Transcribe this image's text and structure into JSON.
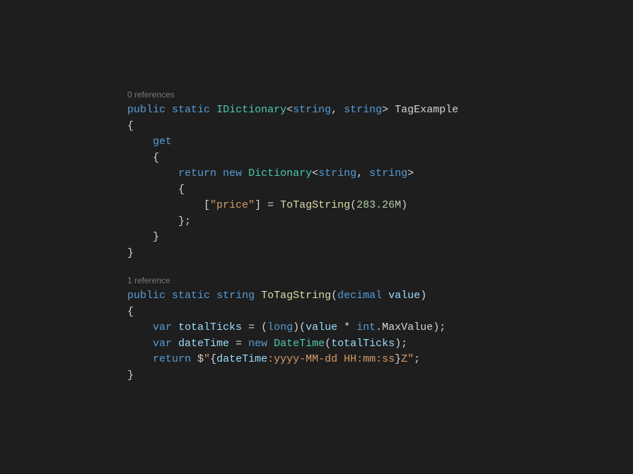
{
  "block1": {
    "codelens": "0 references",
    "l1": {
      "k_public": "public",
      "k_static": "static",
      "t_idict": "IDictionary",
      "lt": "<",
      "k_string1": "string",
      "comma": ", ",
      "k_string2": "string",
      "gt": "> ",
      "name": "TagExample"
    },
    "l2": "{",
    "l3_guide": "    ",
    "l3_get": "get",
    "l4_guide": "    ",
    "l4_brace": "{",
    "l5_guide": "        ",
    "l5_return": "return",
    "l5_new": "new",
    "l5_dict": "Dictionary",
    "l5_lt": "<",
    "l5_s1": "string",
    "l5_comma": ", ",
    "l5_s2": "string",
    "l5_gt": ">",
    "l6_guide": "        ",
    "l6_brace": "{",
    "l7_guide": "            ",
    "l7_lbrack": "[",
    "l7_str": "\"price\"",
    "l7_rbrack_eq": "] = ",
    "l7_method": "ToTagString",
    "l7_lp": "(",
    "l7_num": "283.26M",
    "l7_rp": ")",
    "l8_guide": "        ",
    "l8_close": "};",
    "l9_guide": "    ",
    "l9_brace": "}",
    "l10": "}"
  },
  "block2": {
    "codelens": "1 reference",
    "l1": {
      "k_public": "public",
      "k_static": "static",
      "k_string": "string",
      "name": "ToTagString",
      "lp": "(",
      "k_decimal": "decimal",
      "param": "value",
      "rp": ")"
    },
    "l2": "{",
    "l3_guide": "    ",
    "l3_var": "var",
    "l3_ident": "totalTicks",
    "l3_eq": " = (",
    "l3_long": "long",
    "l3_rp_lp": ")(",
    "l3_value": "value",
    "l3_mul": " * ",
    "l3_int": "int",
    "l3_dot": ".",
    "l3_max": "MaxValue",
    "l3_end": ");",
    "l4_guide": "    ",
    "l4_var": "var",
    "l4_ident": "dateTime",
    "l4_eq": " = ",
    "l4_new": "new",
    "l4_type": "DateTime",
    "l4_lp": "(",
    "l4_arg": "totalTicks",
    "l4_rp": ");",
    "l5_guide": "    ",
    "l5_return": "return",
    "l5_dollar": " $",
    "l5_q1": "\"",
    "l5_lb": "{",
    "l5_dt": "dateTime",
    "l5_fmt": ":yyyy-MM-dd HH:mm:ss",
    "l5_rb": "}",
    "l5_z": "Z\"",
    "l5_semi": ";",
    "l6": "}"
  }
}
